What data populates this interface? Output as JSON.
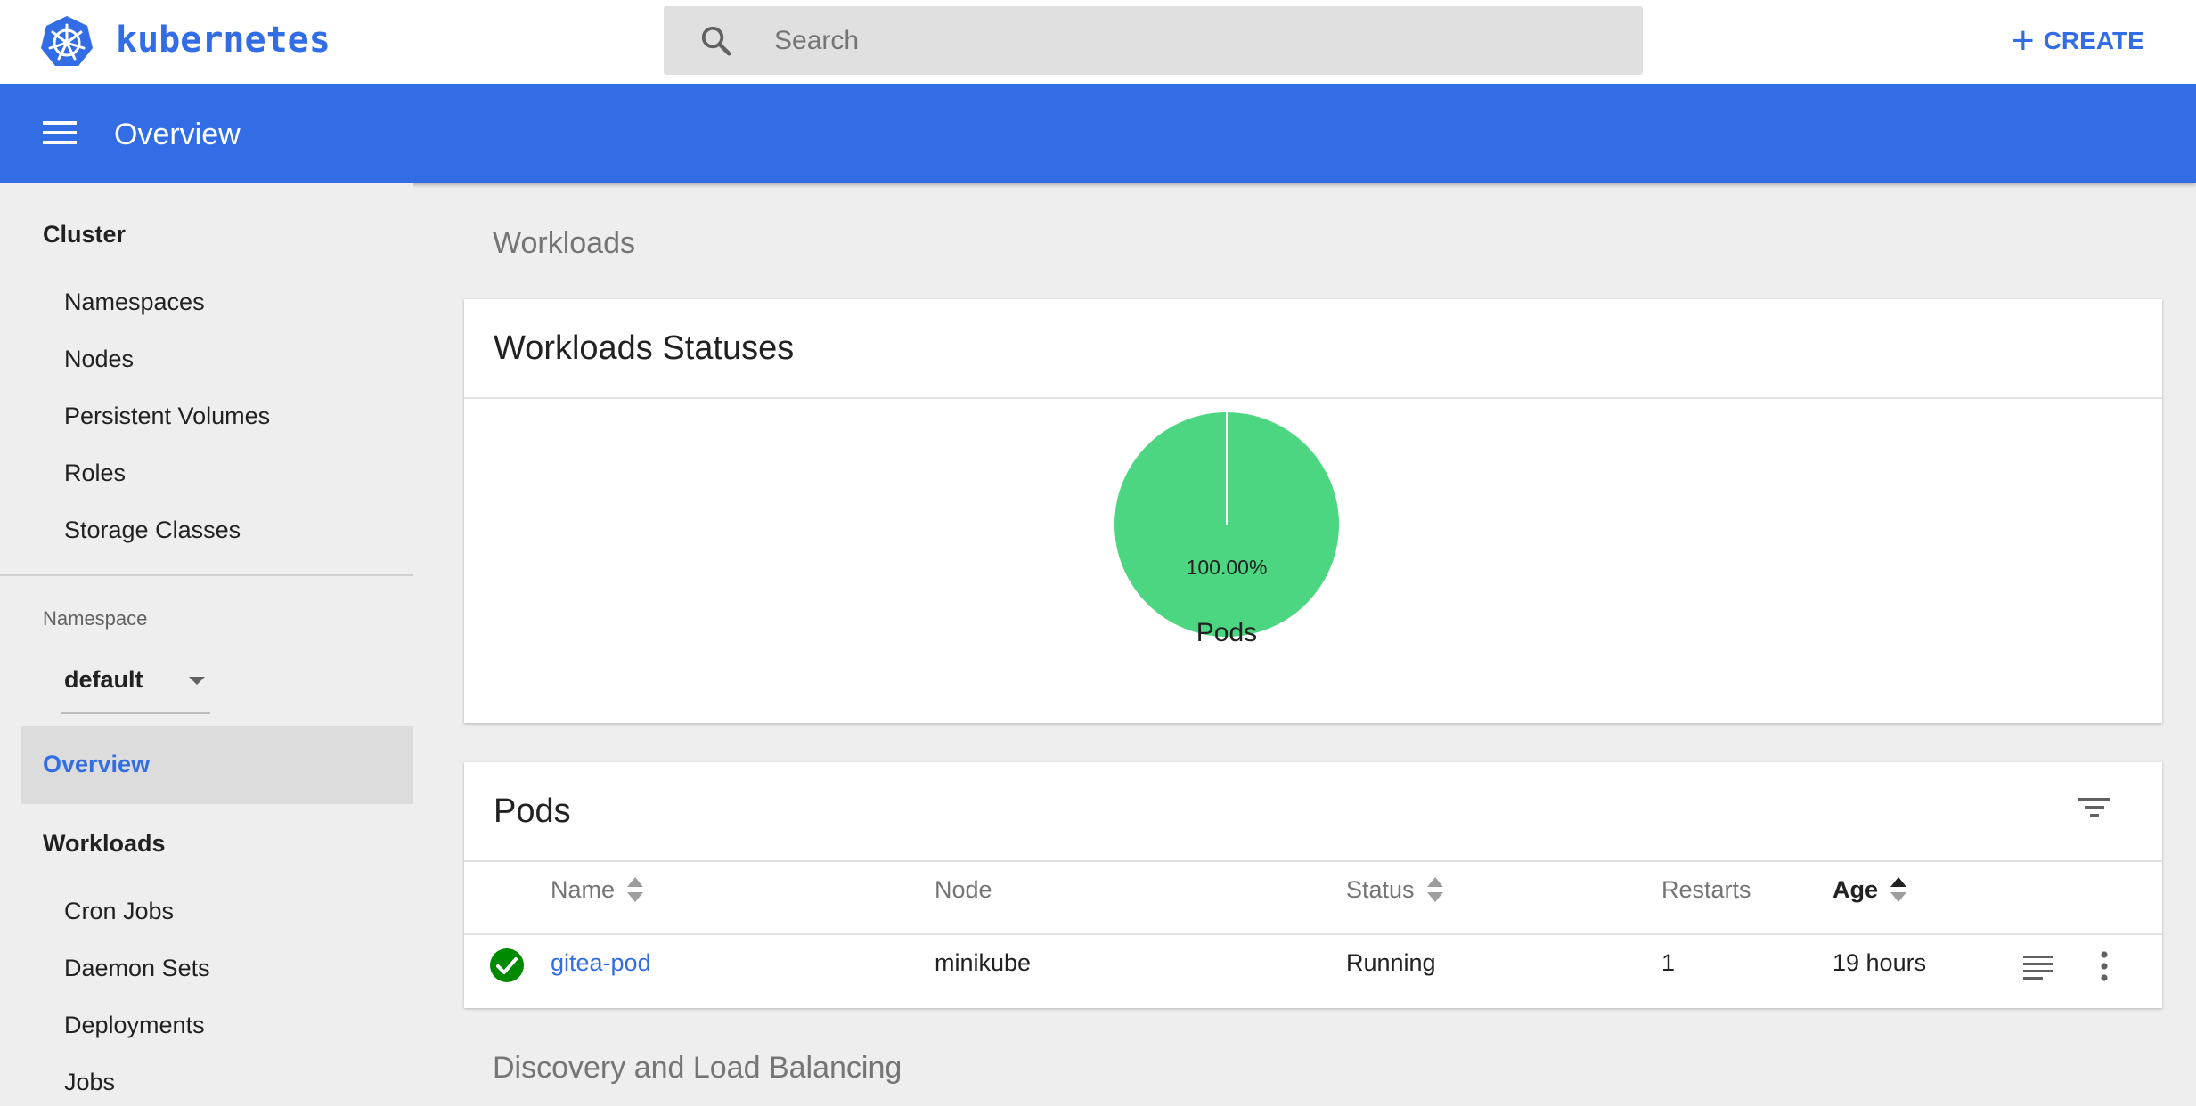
{
  "topbar": {
    "brand": "kubernetes",
    "search_placeholder": "Search",
    "create_label": "CREATE"
  },
  "header": {
    "title": "Overview"
  },
  "sidebar": {
    "cluster_label": "Cluster",
    "cluster_items": [
      "Namespaces",
      "Nodes",
      "Persistent Volumes",
      "Roles",
      "Storage Classes"
    ],
    "namespace_label": "Namespace",
    "namespace_value": "default",
    "overview_label": "Overview",
    "workloads_label": "Workloads",
    "workload_items": [
      "Cron Jobs",
      "Daemon Sets",
      "Deployments",
      "Jobs"
    ]
  },
  "main": {
    "workloads_heading": "Workloads",
    "statuses_card": {
      "title": "Workloads Statuses",
      "chart_label": "Pods"
    },
    "pods_card": {
      "title": "Pods",
      "columns": [
        "Name",
        "Node",
        "Status",
        "Restarts",
        "Age"
      ],
      "rows": [
        {
          "name": "gitea-pod",
          "node": "minikube",
          "status": "Running",
          "restarts": "1",
          "age": "19 hours"
        }
      ]
    },
    "discovery_heading": "Discovery and Load Balancing"
  },
  "colors": {
    "brand_blue": "#326de6",
    "running_green": "#4cd681",
    "success_green": "#008a00"
  },
  "chart_data": {
    "type": "pie",
    "title": "",
    "label": "Pods",
    "slices": [
      {
        "name": "",
        "value": 100.0,
        "display": "100.00%",
        "color": "#4cd681"
      }
    ]
  }
}
